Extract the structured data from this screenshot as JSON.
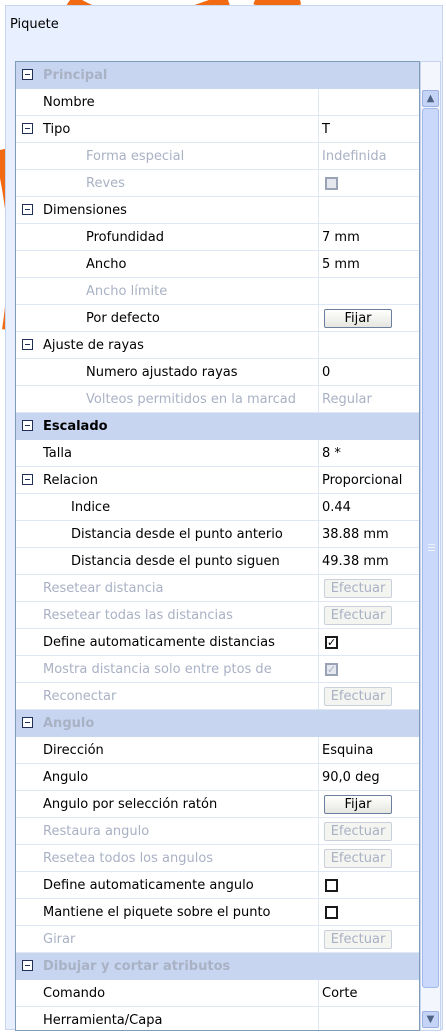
{
  "window": {
    "title": "Piquete"
  },
  "colors": {
    "category_bg": "#c7d5f1",
    "disabled_text": "#a9b1c4",
    "panel_bg": "#e8f0ff"
  },
  "rows": [
    {
      "label": "Principal",
      "type": "cat",
      "disabled": true,
      "toggle": true
    },
    {
      "label": "Nombre",
      "indent": 0
    },
    {
      "label": "Tipo",
      "toggle": true,
      "value": "T"
    },
    {
      "label": "Forma especial",
      "indent": 2,
      "disabled": true,
      "value": "Indefinida"
    },
    {
      "label": "Reves",
      "indent": 2,
      "disabled": true,
      "check": false
    },
    {
      "label": "Dimensiones",
      "toggle": true
    },
    {
      "label": "Profundidad",
      "indent": 2,
      "value": "7 mm"
    },
    {
      "label": "Ancho",
      "indent": 2,
      "value": "5 mm"
    },
    {
      "label": "Ancho límite",
      "indent": 2,
      "disabled": true
    },
    {
      "label": "Por defecto",
      "indent": 2,
      "button": "Fijar"
    },
    {
      "label": "Ajuste de rayas",
      "toggle": true
    },
    {
      "label": "Numero ajustado rayas",
      "indent": 2,
      "value": "0"
    },
    {
      "label": "Volteos permitidos en la marcad",
      "indent": 2,
      "disabled": true,
      "value": "Regular"
    },
    {
      "label": "Escalado",
      "type": "cat",
      "toggle": true
    },
    {
      "label": "Talla",
      "indent": 0,
      "value": "8 *"
    },
    {
      "label": "Relacion",
      "toggle": true,
      "value": "Proporcional"
    },
    {
      "label": "Indice",
      "indent": 1,
      "value": "0.44"
    },
    {
      "label": "Distancia desde el punto anterio",
      "indent": 1,
      "value": "38.88 mm"
    },
    {
      "label": "Distancia desde el punto siguen",
      "indent": 1,
      "value": "49.38 mm"
    },
    {
      "label": "Resetear distancia",
      "indent": 0,
      "disabled": true,
      "button": "Efectuar"
    },
    {
      "label": "Resetear todas las distancias",
      "indent": 0,
      "disabled": true,
      "button": "Efectuar"
    },
    {
      "label": "Define automaticamente distancias",
      "indent": 0,
      "check": true
    },
    {
      "label": "Mostra distancia solo entre ptos de",
      "indent": 0,
      "disabled": true,
      "check": true
    },
    {
      "label": "Reconectar",
      "indent": 0,
      "disabled": true,
      "button": "Efectuar"
    },
    {
      "label": "Angulo",
      "type": "cat",
      "disabled": true,
      "toggle": true
    },
    {
      "label": "Dirección",
      "indent": 0,
      "value": "Esquina"
    },
    {
      "label": "Angulo",
      "indent": 0,
      "value": "90,0 deg"
    },
    {
      "label": "Angulo por selección ratón",
      "indent": 0,
      "button": "Fijar"
    },
    {
      "label": "Restaura angulo",
      "indent": 0,
      "disabled": true,
      "button": "Efectuar"
    },
    {
      "label": "Resetea todos los angulos",
      "indent": 0,
      "disabled": true,
      "button": "Efectuar"
    },
    {
      "label": "Define automaticamente angulo",
      "indent": 0,
      "check": false
    },
    {
      "label": "Mantiene el piquete sobre el punto",
      "indent": 0,
      "check": false
    },
    {
      "label": "Girar",
      "indent": 0,
      "disabled": true,
      "button": "Efectuar"
    },
    {
      "label": "Dibujar y cortar atributos",
      "type": "cat",
      "disabled": true,
      "toggle": true
    },
    {
      "label": "Comando",
      "indent": 0,
      "value": "Corte"
    },
    {
      "label": "Herramienta/Capa",
      "indent": 0
    }
  ],
  "scrollbar": {
    "up_icon": "chevron-up-icon",
    "down_icon": "chevron-down-icon"
  }
}
